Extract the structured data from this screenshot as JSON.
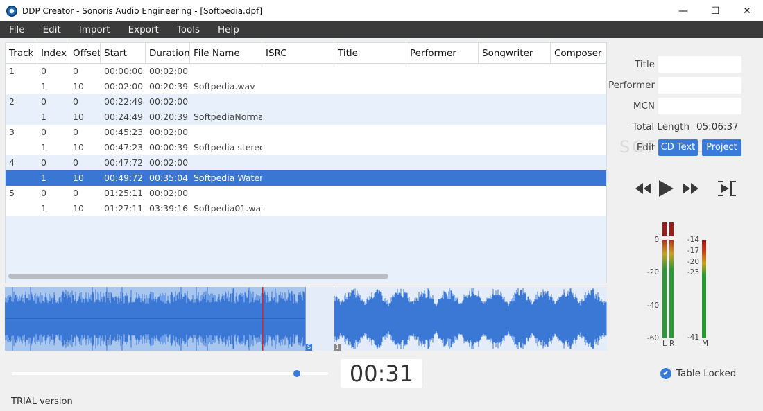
{
  "window": {
    "title": "DDP Creator - Sonoris Audio Engineering - [Softpedia.dpf]"
  },
  "window_controls": {
    "minimize": "—",
    "maximize": "☐",
    "close": "✕"
  },
  "menu": [
    "File",
    "Edit",
    "Import",
    "Export",
    "Tools",
    "Help"
  ],
  "table": {
    "columns": [
      "Track",
      "Index",
      "Offset",
      "Start",
      "Duration",
      "File Name",
      "ISRC",
      "Title",
      "Performer",
      "Songwriter",
      "Composer"
    ],
    "rows": [
      {
        "track": "1",
        "index": "0",
        "offset": "0",
        "start": "00:00:00",
        "duration": "00:02:00",
        "file": ""
      },
      {
        "track": "",
        "index": "1",
        "offset": "10",
        "start": "00:02:00",
        "duration": "00:20:39",
        "file": "Softpedia.wav"
      },
      {
        "track": "2",
        "index": "0",
        "offset": "0",
        "start": "00:22:49",
        "duration": "00:02:00",
        "file": ""
      },
      {
        "track": "",
        "index": "1",
        "offset": "10",
        "start": "00:24:49",
        "duration": "00:20:39",
        "file": "SoftpediaNormal"
      },
      {
        "track": "3",
        "index": "0",
        "offset": "0",
        "start": "00:45:23",
        "duration": "00:02:00",
        "file": ""
      },
      {
        "track": "",
        "index": "1",
        "offset": "10",
        "start": "00:47:23",
        "duration": "00:00:39",
        "file": "Softpedia stereo"
      },
      {
        "track": "4",
        "index": "0",
        "offset": "0",
        "start": "00:47:72",
        "duration": "00:02:00",
        "file": ""
      },
      {
        "track": "",
        "index": "1",
        "offset": "10",
        "start": "00:49:72",
        "duration": "00:35:04",
        "file": "Softpedia Waterr"
      },
      {
        "track": "5",
        "index": "0",
        "offset": "0",
        "start": "01:25:11",
        "duration": "00:02:00",
        "file": ""
      },
      {
        "track": "",
        "index": "1",
        "offset": "10",
        "start": "01:27:11",
        "duration": "03:39:16",
        "file": "Softpedia01.wav"
      }
    ],
    "selected_row": 7
  },
  "waveform": {
    "marker_s": "S",
    "marker_1": "1",
    "playhead_color": "#e02020",
    "wave_color": "#3b78d6"
  },
  "project": {
    "title_label": "Title",
    "performer_label": "Performer",
    "mcn_label": "MCN",
    "total_length_label": "Total Length",
    "total_length_value": "05:06:37",
    "edit_label": "Edit",
    "cd_text_button": "CD Text",
    "project_button": "Project"
  },
  "meters": {
    "left_scale": [
      "0",
      "-20",
      "-40",
      "-60"
    ],
    "right_scale": [
      "-14",
      "-17",
      "-20",
      "-23",
      "-41"
    ],
    "l_label": "L",
    "r_label": "R",
    "m_label": "M"
  },
  "playback": {
    "time": "00:31",
    "position": 0.89
  },
  "table_locked_label": "Table Locked",
  "trial_label": "TRIAL version",
  "watermark": "SOFTPEDIA",
  "colors": {
    "accent": "#3a7ad9",
    "selected_row": "#3a77d4",
    "menubar": "#3b3b3b"
  }
}
